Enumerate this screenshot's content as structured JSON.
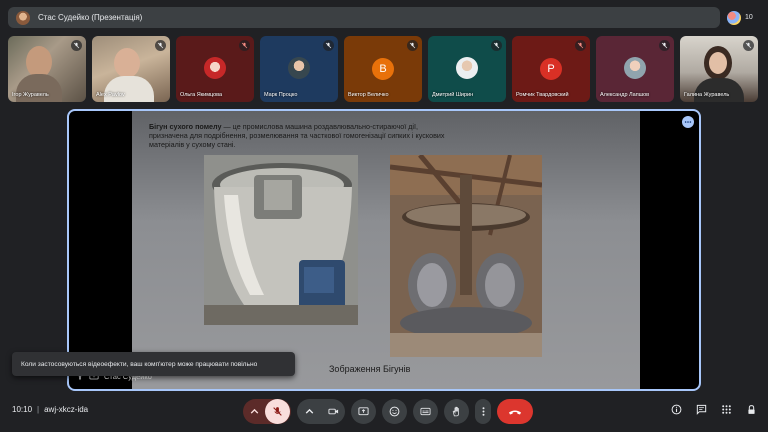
{
  "meeting": {
    "title": "Стас Судейко (Презентація)",
    "participant_count": "10",
    "time": "10:10",
    "separator": "|",
    "code": "awj-xkcz-ida"
  },
  "participants": [
    {
      "name": "Ігор Журавель",
      "mic": "muted",
      "kind": "video"
    },
    {
      "name": "Alex Pavlov",
      "mic": "muted",
      "kind": "video"
    },
    {
      "name": "Ольга Якимцова",
      "mic": "muted",
      "kind": "photo"
    },
    {
      "name": "Марк Процко",
      "mic": "muted",
      "kind": "photo"
    },
    {
      "name": "Виктор Величко",
      "mic": "muted",
      "kind": "letter",
      "letter": "В",
      "color": "#e8710a"
    },
    {
      "name": "Дмитрий Ширин",
      "mic": "muted",
      "kind": "photo"
    },
    {
      "name": "Ромчик Твардовский",
      "mic": "muted",
      "kind": "letter",
      "letter": "Р",
      "color": "#d93025"
    },
    {
      "name": "Александр Лапшов",
      "mic": "muted",
      "kind": "photo"
    },
    {
      "name": "Галина Журавель",
      "mic": "muted",
      "kind": "video"
    }
  ],
  "slide": {
    "term": "Бігун сухого помелу",
    "definition": " — це промислова машина роздавлювально-стираючої дії, призначена для подрібнення, розмелювання та часткової гомогенізації сипких і кускових матеріалів у сухому стані.",
    "caption": "Зображення Бігунів"
  },
  "presenter": {
    "name": "Стас Судейко"
  },
  "toast": {
    "message": "Коли застосовуються відеоефекти, ваш комп'ютер може працювати повільно"
  },
  "colors": {
    "background": "#202124",
    "tile": "#3c4043",
    "accent": "#a8c7fa",
    "hangup": "#dc362e",
    "mic_off": "#f9dedc"
  },
  "icons": {
    "controls": [
      "chevron-up-icon",
      "mic-off-icon",
      "chevron-up-icon",
      "camera-icon",
      "present-screen-icon",
      "emoji-icon",
      "captions-icon",
      "raise-hand-icon",
      "more-vert-icon",
      "hangup-icon"
    ],
    "right": [
      "info-icon",
      "chat-icon",
      "apps-icon",
      "lock-icon"
    ]
  }
}
